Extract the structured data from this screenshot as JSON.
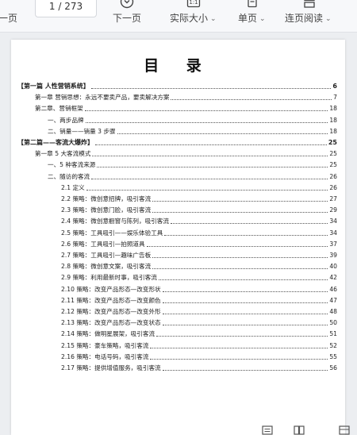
{
  "toolbar": {
    "prev_label": "上一页",
    "page_current": "1",
    "page_total": "273",
    "next_label": "下一页",
    "zoom_label": "实际大小",
    "view_mode_label": "单页",
    "scroll_mode_label": "连页阅读"
  },
  "document": {
    "title": "目 录",
    "entries": [
      {
        "label": "【第一篇  人性营销系统】",
        "page": "6",
        "level": 0
      },
      {
        "label": "第一章  营销思想：永远不要卖产品，要卖解决方案",
        "page": "7",
        "level": 1
      },
      {
        "label": "第二章、营销框架",
        "page": "18",
        "level": 1
      },
      {
        "label": "一、两步品牌",
        "page": "18",
        "level": 2
      },
      {
        "label": "二、销量——销量 3 步骤",
        "page": "18",
        "level": 2
      },
      {
        "label": "【第二篇——客流大爆炸】",
        "page": "25",
        "level": 0
      },
      {
        "label": "第一章 5 大客流模式",
        "page": "25",
        "level": 1
      },
      {
        "label": "一、5 种客流来源",
        "page": "25",
        "level": 2
      },
      {
        "label": "二、随访的客流",
        "page": "26",
        "level": 2
      },
      {
        "label": "2.1 定义",
        "page": "26",
        "level": 3
      },
      {
        "label": "2.2 策略：微创意招牌，吸引客流",
        "page": "27",
        "level": 3
      },
      {
        "label": "2.3 策略：微创意门脸，吸引客流",
        "page": "29",
        "level": 3
      },
      {
        "label": "2.4 策略：微创意橱窗与陈列，吸引客流",
        "page": "34",
        "level": 3
      },
      {
        "label": "2.5 策略：工具吸引——娱乐体验工具",
        "page": "34",
        "level": 3
      },
      {
        "label": "2.6 策略：工具吸引—拍照道具",
        "page": "37",
        "level": 3
      },
      {
        "label": "2.7 策略：工具吸引—趣味广告板",
        "page": "39",
        "level": 3
      },
      {
        "label": "2.8 策略：微创意文案，吸引客流",
        "page": "40",
        "level": 3
      },
      {
        "label": "2.9 策略：利用最新时事，吸引客流",
        "page": "42",
        "level": 3
      },
      {
        "label": "2.10 策略：改变产品形态—改变形状",
        "page": "46",
        "level": 3
      },
      {
        "label": "2.11 策略：改变产品形态—改变颜色",
        "page": "47",
        "level": 3
      },
      {
        "label": "2.12 策略：改变产品形态—改变外形",
        "page": "48",
        "level": 3
      },
      {
        "label": "2.13 策略：改变产品形态—改变状态",
        "page": "50",
        "level": 3
      },
      {
        "label": "2.14 策略：做明星展架，吸引客流",
        "page": "51",
        "level": 3
      },
      {
        "label": "2.15 策略：豪车策略，吸引客流",
        "page": "52",
        "level": 3
      },
      {
        "label": "2.16 策略：电话号码，吸引客流",
        "page": "55",
        "level": 3
      },
      {
        "label": "2.17 策略：提供增值服务，吸引客流",
        "page": "56",
        "level": 3
      }
    ]
  },
  "icons": {
    "next": "circle-arrow-down-icon",
    "zoom": "fit-actual-size-icon",
    "view_mode": "single-page-icon",
    "scroll_mode": "continuous-pages-icon"
  }
}
